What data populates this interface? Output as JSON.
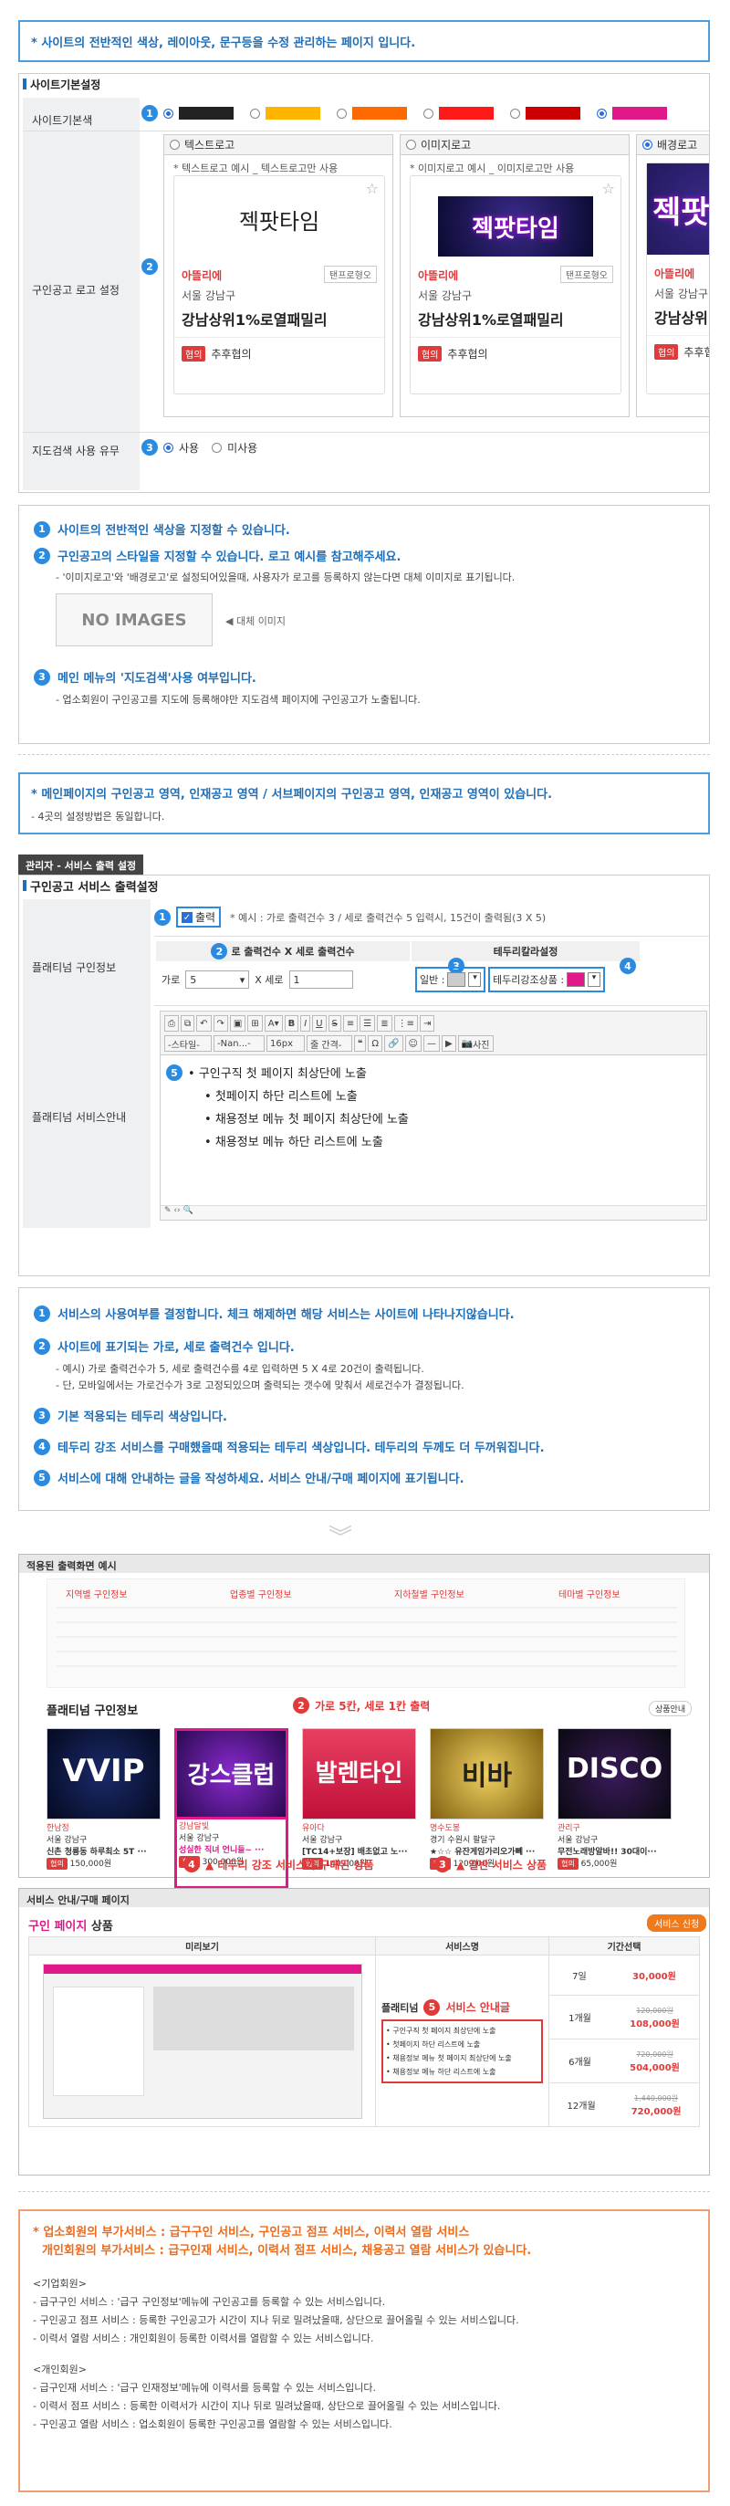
{
  "top_notice": "* 사이트의 전반적인 색상, 레이아웃, 문구등을 수정 관리하는 페이지 입니다.",
  "site_settings": {
    "title": "사이트기본설정",
    "color_label": "사이트기본색",
    "colors": [
      "#222222",
      "#ffb400",
      "#ff6a00",
      "#ff1a1a",
      "#cc0000",
      "#e0188a"
    ],
    "logo_label": "구인공고 로고 설정",
    "map_label": "지도검색 사용 유무",
    "map_options": [
      "사용",
      "미사용"
    ]
  },
  "logo_cards": [
    {
      "name": "텍스트로고",
      "example": "* 텍스트로고 예시 _ 텍스트로고만 사용",
      "logo": "젝팟타임",
      "company": "아뜰리에",
      "badge": "탠프로형오",
      "location": "서울 강남구",
      "title": "강남상위1%로열패밀리",
      "tag": "협의",
      "pay": "추후협의"
    },
    {
      "name": "이미지로고",
      "example": "* 이미지로고 예시 _ 이미지로고만 사용",
      "logo": "젝팟타임",
      "company": "아뜰리에",
      "badge": "탠프로형오",
      "location": "서울 강남구",
      "title": "강남상위1%로열패밀리",
      "tag": "협의",
      "pay": "추후협의"
    },
    {
      "name": "배경로고",
      "logo": "젝팟",
      "company": "아뜰리에",
      "location": "서울 강남구",
      "title": "강남상위",
      "tag": "협의",
      "pay": "추후협"
    }
  ],
  "info1": {
    "item1": "사이트의 전반적인 색상을 지정할 수 있습니다.",
    "item2": "구인공고의 스타일을 지정할 수 있습니다. 로고 예시를 참고해주세요.",
    "item2_note": "- '이미지로고'와 '배경로고'로 설정되어있을때, 사용자가 로고를 등록하지 않는다면 대체 이미지로 표기됩니다.",
    "no_images": "NO IMAGES",
    "alt_label": "◀ 대체 이미지",
    "item3": "메인 메뉴의 '지도검색'사용 여부입니다.",
    "item3_note": "- 업소회원이 구인공고를 지도에 등록해야만 지도검색 페이지에 구인공고가 노출됩니다."
  },
  "notice2": {
    "line1": "* 메인페이지의 구인공고 영역, 인재공고 영역 / 서브페이지의 구인공고 영역, 인재공고 영역이 있습니다.",
    "line2": "- 4곳의 설정방법은 동일합니다."
  },
  "service": {
    "breadcrumb": "관리자 - 서비스 출력 설정",
    "title": "구인공고 서비스 출력설정",
    "output_label": "출력",
    "output_example": "* 예시 : 가로 출력건수 3 / 세로 출력건수 5 입력시, 15건이 출력됨(3 X 5)",
    "platinum_label": "플래티넘 구인정보",
    "count_header": "로 출력건수 X 세로 출력건수",
    "border_header": "테두리칼라설정",
    "horiz_label": "가로",
    "horiz_value": "5",
    "x_label": "X 세로",
    "vert_value": "1",
    "normal_label": "일반 :",
    "strong_label": "테두리강조상품 :",
    "normal_color": "#cccccc",
    "strong_color": "#e0188a",
    "guide_label": "플래티넘 서비스안내",
    "toolbar": {
      "style": "-스타일-",
      "font": "-Nan...-",
      "size": "16px",
      "interval": "줄 간격-",
      "photo": "사진"
    },
    "bullets": [
      "구인구직 첫 페이지 최상단에 노출",
      "첫페이지 하단 리스트에 노출",
      "채용정보 메뉴 첫 페이지 최상단에 노출",
      "채용정보 메뉴 하단 리스트에 노출"
    ]
  },
  "info2": {
    "item1": "서비스의 사용여부를 결정합니다. 체크 해제하면 해당 서비스는 사이트에 나타나지않습니다.",
    "item2": "사이트에 표기되는 가로, 세로 출력건수 입니다.",
    "item2_note1": "- 예시) 가로 출력건수가 5, 세로 출력건수를 4로 입력하면 5 X 4로 20건이 출력됩니다.",
    "item2_note2": "- 단, 모바일에서는 가로건수가 3로 고정되있으며 출력되는 갯수에 맞춰서 세로건수가 결정됩니다.",
    "item3": "기본 적용되는 테두리 색상입니다.",
    "item4": "테두리 강조 서비스를 구매했을때 적용되는 테두리 색상입니다. 테두리의 두께도 더 두꺼워집니다.",
    "item5": "서비스에 대해 안내하는 글을 작성하세요. 서비스 안내/구매 페이지에 표기됩니다."
  },
  "example": {
    "title": "적용된 출력화면 예시",
    "tabs": [
      "지역별 구인정보",
      "업종별 구인정보",
      "지하철별 구인정보",
      "테마별 구인정보"
    ],
    "section": "플래티넘 구인정보",
    "more": "상품안내",
    "annot_count": "가로 5칸, 세로 1칸 출력",
    "annot_strong": "▲ 테두리 강조 서비스가 구매된 상품",
    "annot_normal": "▲ 일반 서비스 상품",
    "items": [
      {
        "logo": "VVIP",
        "company": "한남정",
        "loc": "서울 강남구",
        "title": "신촌 청룡동 하루최소 5T ···",
        "pay": "150,000원"
      },
      {
        "logo": "강스클럽",
        "company": "강남달빛",
        "loc": "서울 강남구",
        "title": "성실한 직녀 언니들~ ···",
        "pay": "300,000원"
      },
      {
        "logo": "발렌타인",
        "company": "유아다",
        "loc": "서울 강남구",
        "title": "[TC14+보장] 배초없고 노···",
        "pay": "140,000원"
      },
      {
        "logo": "비바",
        "company": "명수도봉",
        "loc": "경기 수원시 팔달구",
        "title": "★☆☆ 유잔게임가리오가뻬 ···",
        "pay": "120,000원"
      },
      {
        "logo": "DISCO",
        "company": "관리구",
        "loc": "서울 강남구",
        "title": "무전노래방알바!! 30대이···",
        "pay": "65,000원"
      }
    ]
  },
  "purchase": {
    "title": "서비스 안내/구매 페이지",
    "heading_a": "구인 페이지",
    "heading_b": "상품",
    "buy": "서비스 신청",
    "col_preview": "미리보기",
    "col_service": "서비스명",
    "col_period": "기간선택",
    "service_name": "플래티넘",
    "annot": "서비스 안내글",
    "bullets": [
      "구인구직 첫 페이지 최상단에 노출",
      "첫페이지 하단 리스트에 노출",
      "채용정보 메뉴 첫 페이지 최상단에 노출",
      "채용정보 메뉴 하단 리스트에 노출"
    ],
    "periods": [
      {
        "period": "7일",
        "price": "30,000원"
      },
      {
        "period": "1개월",
        "old": "120,000원",
        "price": "108,000원"
      },
      {
        "period": "6개월",
        "old": "720,000원",
        "price": "504,000원"
      },
      {
        "period": "12개월",
        "old": "1,440,000원",
        "price": "720,000원"
      }
    ]
  },
  "bottom": {
    "line1": "* 업소회원의 부가서비스 :  급구구인 서비스, 구인공고 점프 서비스, 이력서 열람 서비스",
    "line2": "개인회원의 부가서비스 :  급구인재 서비스, 이력서 점프 서비스, 채용공고 열람 서비스가 있습니다.",
    "biz_head": "<기업회원>",
    "biz": [
      "- 급구구인 서비스 : '급구 구인정보'메뉴에 구인공고를 등록할 수 있는 서비스입니다.",
      "- 구인공고 점프 서비스 : 등록한 구인공고가 시간이 지나 뒤로 밀려났을때, 상단으로 끌어올릴 수 있는 서비스입니다.",
      "- 이력서 열람 서비스 : 개인회원이 등록한 이력서를 열람할 수 있는 서비스입니다."
    ],
    "per_head": "<개인회원>",
    "per": [
      "- 급구인재 서비스 : '급구 인재정보'메뉴에 이력서를 등록할 수 있는 서비스입니다.",
      "- 이력서 점프 서비스 : 등록한 이력서가 시간이 지나 뒤로 밀려났을때, 상단으로 끌어올릴 수 있는 서비스입니다.",
      "- 구인공고 열람 서비스 : 업소회원이 등록한 구인공고를 열람할 수 있는 서비스입니다."
    ]
  }
}
